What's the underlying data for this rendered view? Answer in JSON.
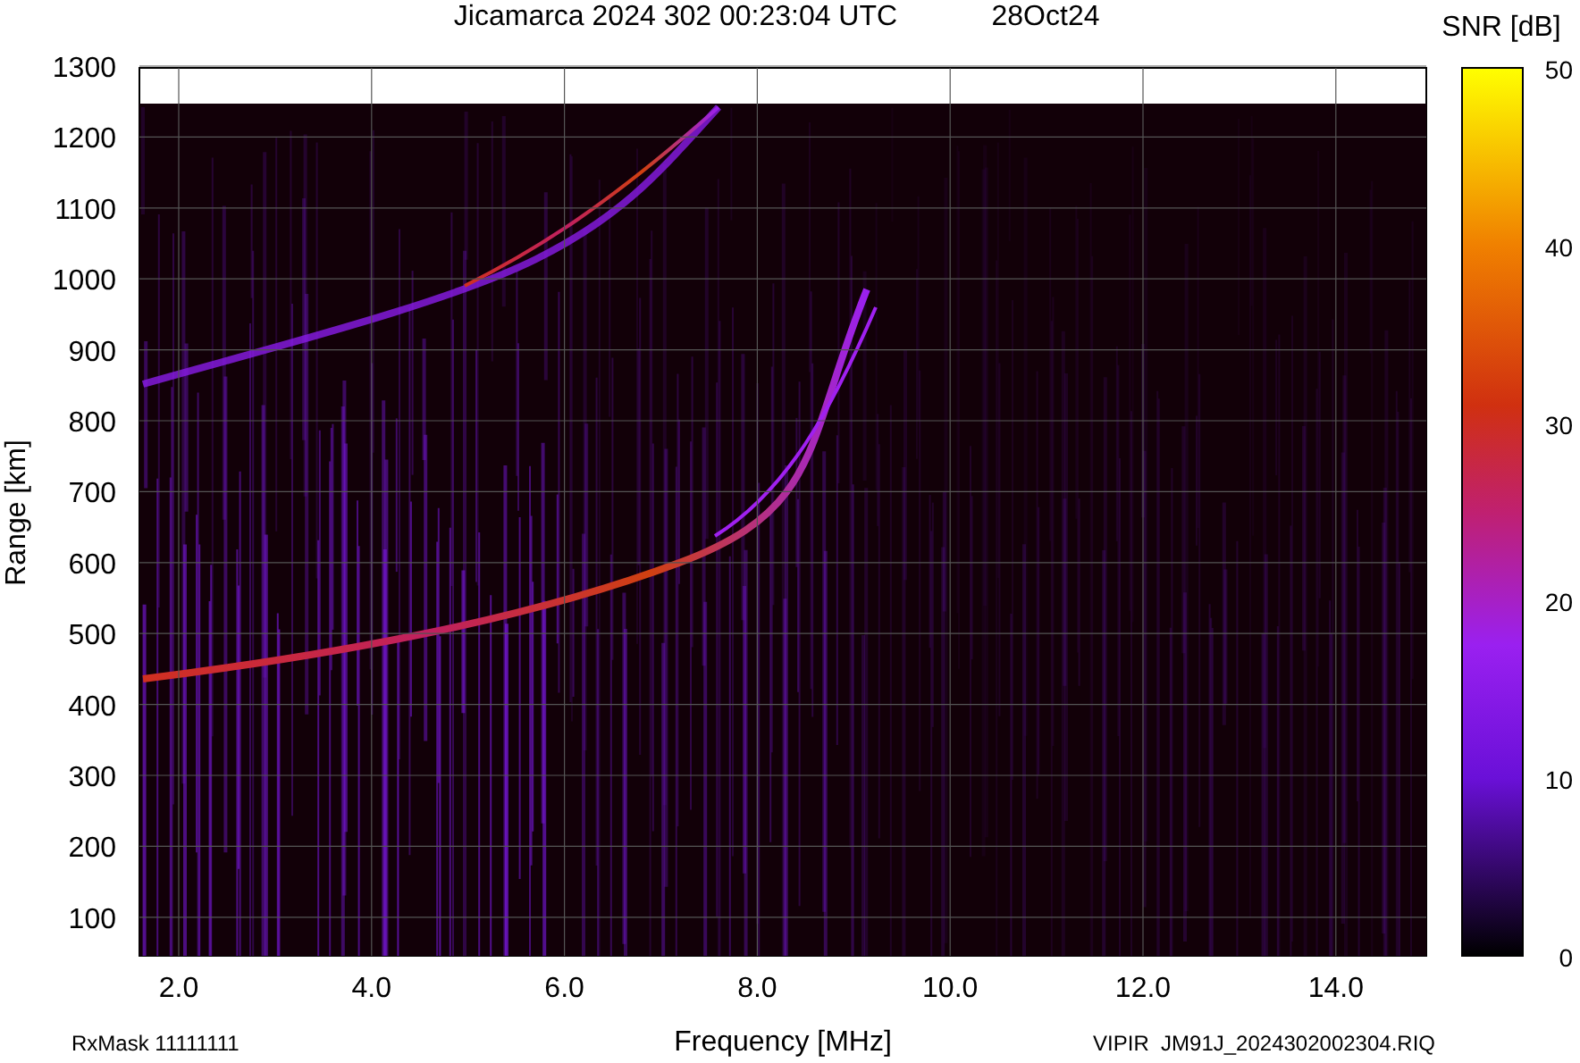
{
  "title": "Jicamarca 2024 302 00:23:04 UTC",
  "date": "28Oct24",
  "y_axis": {
    "label": "Range [km]",
    "ticks": [
      "1300",
      "1200",
      "1100",
      "1000",
      "900",
      "800",
      "700",
      "600",
      "500",
      "400",
      "300",
      "200",
      "100"
    ]
  },
  "x_axis": {
    "label": "Frequency [MHz]",
    "ticks": [
      "2.0",
      "4.0",
      "6.0",
      "8.0",
      "10.0",
      "12.0",
      "14.0"
    ]
  },
  "colorbar": {
    "title": "SNR [dB]",
    "ticks": [
      "50",
      "40",
      "30",
      "20",
      "10",
      "0"
    ]
  },
  "footer": {
    "rx_mask": "RxMask 11111111",
    "file": "VIPIR  JM91J_2024302002304.RIQ"
  }
}
